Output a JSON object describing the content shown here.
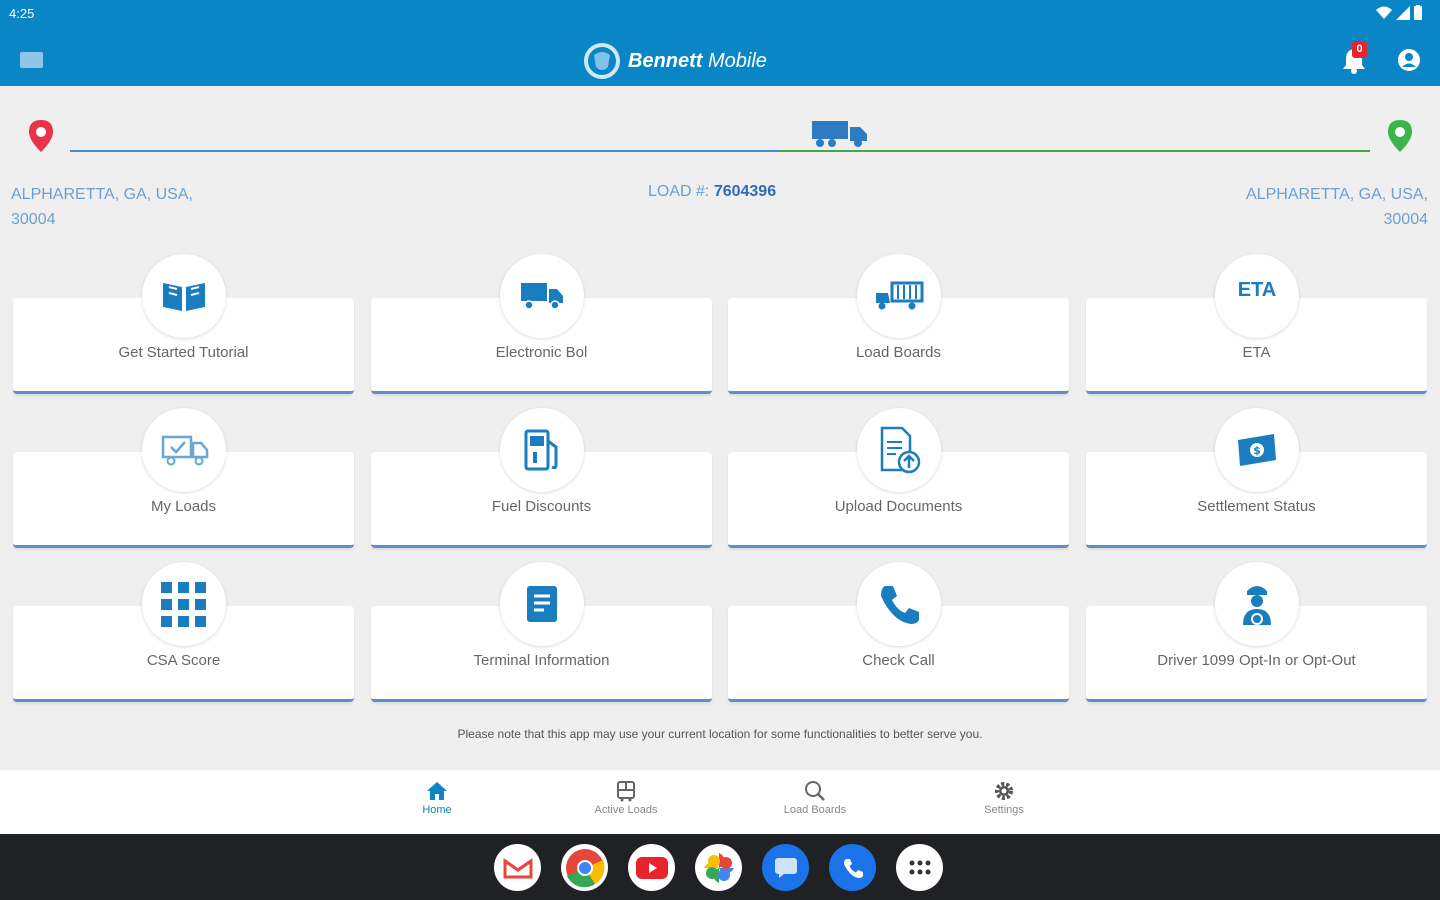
{
  "status_bar": {
    "time": "4:25"
  },
  "app_bar": {
    "brand_bold": "Bennett",
    "brand_regular": "Mobile",
    "notification_count": "0"
  },
  "route": {
    "origin_line1": "ALPHARETTA, GA, USA,",
    "origin_line2": "30004",
    "destination_line1": "ALPHARETTA, GA, USA,",
    "destination_line2": "30004",
    "load_label": "LOAD #:",
    "load_number": "7604396"
  },
  "tiles": [
    {
      "label": "Get Started Tutorial",
      "icon": "book-icon"
    },
    {
      "label": "Electronic Bol",
      "icon": "truck-icon"
    },
    {
      "label": "Load Boards",
      "icon": "trailer-icon"
    },
    {
      "label": "ETA",
      "icon": "eta-icon",
      "icon_text": "ETA"
    },
    {
      "label": "My Loads",
      "icon": "truck-check-icon"
    },
    {
      "label": "Fuel Discounts",
      "icon": "fuel-pump-icon"
    },
    {
      "label": "Upload Documents",
      "icon": "document-upload-icon"
    },
    {
      "label": "Settlement Status",
      "icon": "money-icon"
    },
    {
      "label": "CSA Score",
      "icon": "grid-icon"
    },
    {
      "label": "Terminal Information",
      "icon": "document-icon"
    },
    {
      "label": "Check Call",
      "icon": "phone-icon"
    },
    {
      "label": "Driver 1099 Opt-In or Opt-Out",
      "icon": "driver-icon"
    }
  ],
  "note": "Please note that this app may use your current location for some functionalities to better serve you.",
  "bottom_nav": [
    {
      "label": "Home",
      "icon": "home-icon",
      "active": true
    },
    {
      "label": "Active Loads",
      "icon": "active-loads-icon",
      "active": false
    },
    {
      "label": "Load Boards",
      "icon": "search-icon",
      "active": false
    },
    {
      "label": "Settings",
      "icon": "gear-icon",
      "active": false
    }
  ],
  "dock_apps": [
    "gmail-icon",
    "chrome-icon",
    "youtube-icon",
    "photos-icon",
    "messages-icon",
    "phone-app-icon",
    "app-drawer-icon"
  ],
  "colors": {
    "primary": "#0a86c6",
    "route_blue": "#3d8ed0",
    "route_green": "#48a546",
    "origin_pin": "#e8334a",
    "destination_pin": "#3bb54a"
  }
}
